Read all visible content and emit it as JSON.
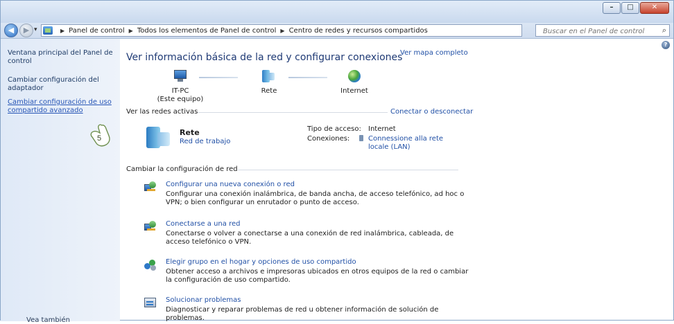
{
  "window": {
    "controls": {
      "minimize": "–",
      "maximize": "□",
      "close": "✕"
    }
  },
  "address": {
    "back_glyph": "◀",
    "forward_glyph": "▶",
    "breadcrumbs": [
      "Panel de control",
      "Todos los elementos de Panel de control",
      "Centro de redes y recursos compartidos"
    ],
    "dropdown_glyph": "▾",
    "refresh_glyph": "⟳",
    "search_placeholder": "Buscar en el Panel de control"
  },
  "sidebar": {
    "home": "Ventana principal del Panel de control",
    "adapter": "Cambiar configuración del adaptador",
    "advanced": "Cambiar configuración de uso compartido avanzado",
    "see_also": "Vea también"
  },
  "main": {
    "title": "Ver información básica de la red y configurar conexiones",
    "view_full_map": "Ver mapa completo",
    "nodes": {
      "pc_name": "IT-PC",
      "pc_sub": "(Este equipo)",
      "network": "Rete",
      "internet": "Internet"
    },
    "active_networks": {
      "header": "Ver las redes activas",
      "connect_link": "Conectar o desconectar",
      "name": "Rete",
      "type": "Red de trabajo",
      "access_label": "Tipo de acceso:",
      "access_value": "Internet",
      "connections_label": "Conexiones:",
      "connections_value": "Connessione alla rete locale (LAN)"
    },
    "change_settings": {
      "header": "Cambiar la configuración de red",
      "tasks": [
        {
          "title": "Configurar una nueva conexión o red",
          "desc": "Configurar una conexión inalámbrica, de banda ancha, de acceso telefónico, ad hoc o VPN; o bien configurar un enrutador o punto de acceso."
        },
        {
          "title": "Conectarse a una red",
          "desc": "Conectarse o volver a conectarse a una conexión de red inalámbrica, cableada, de acceso telefónico o VPN."
        },
        {
          "title": "Elegir grupo en el hogar y opciones de uso compartido",
          "desc": "Obtener acceso a archivos e impresoras ubicados en otros equipos de la red o cambiar la configuración de uso compartido."
        },
        {
          "title": "Solucionar problemas",
          "desc": "Diagnosticar y reparar problemas de red u obtener información de solución de problemas."
        }
      ]
    }
  },
  "step_marker": "5",
  "help_glyph": "?"
}
